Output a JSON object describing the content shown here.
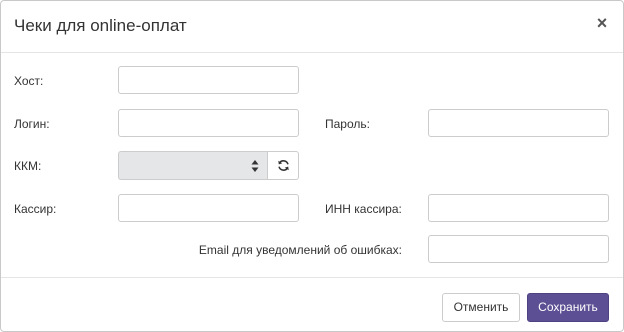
{
  "dialog": {
    "title": "Чеки для online-оплат",
    "close_symbol": "×"
  },
  "form": {
    "host": {
      "label": "Хост:",
      "value": ""
    },
    "login": {
      "label": "Логин:",
      "value": ""
    },
    "password": {
      "label": "Пароль:",
      "value": ""
    },
    "kkm": {
      "label": "ККМ:",
      "selected": "",
      "refresh_icon": "refresh-icon"
    },
    "cashier": {
      "label": "Кассир:",
      "value": ""
    },
    "cashier_inn": {
      "label": "ИНН кассира:",
      "value": ""
    },
    "error_email": {
      "label": "Email для уведомлений об ошибках:",
      "value": ""
    }
  },
  "footer": {
    "cancel_label": "Отменить",
    "save_label": "Сохранить"
  },
  "colors": {
    "primary": "#5d4f94",
    "select_bg": "#e4e6e8"
  }
}
